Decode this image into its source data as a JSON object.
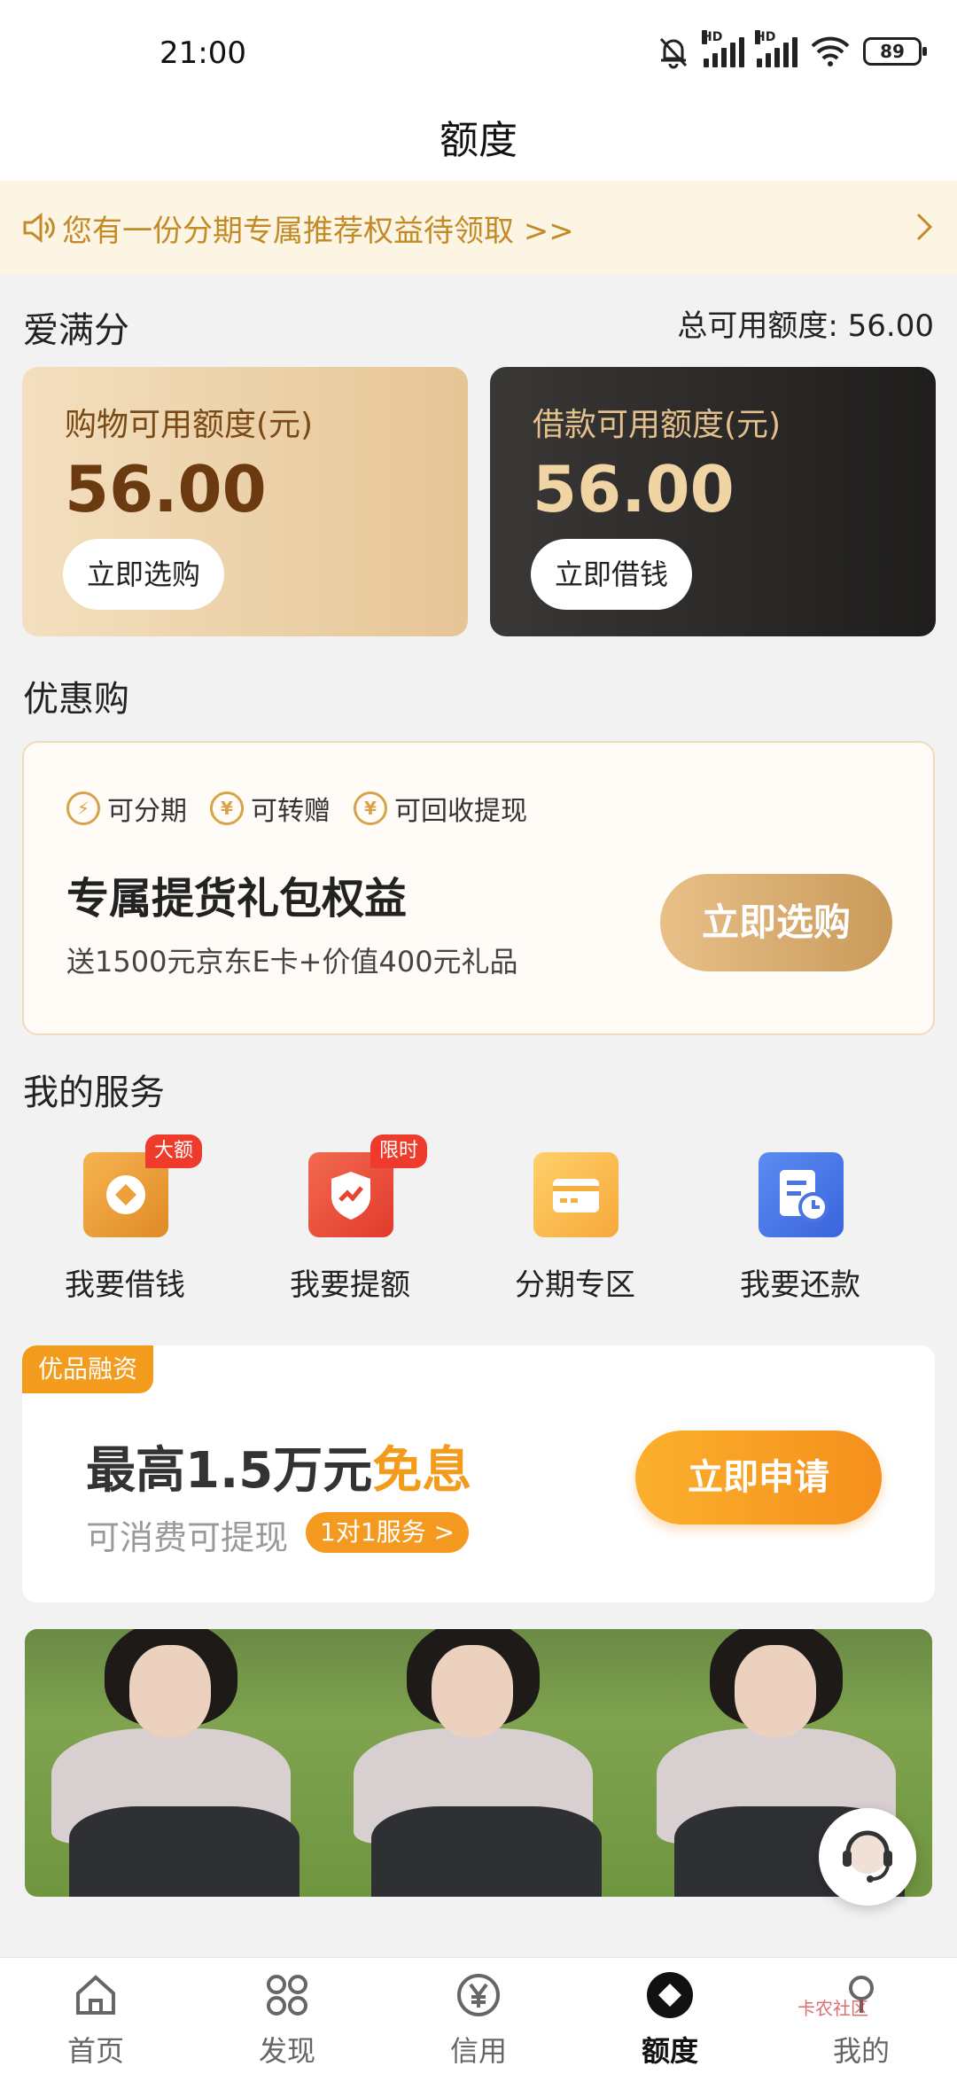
{
  "status": {
    "time": "21:00",
    "battery": "89",
    "hd": "HD"
  },
  "header": {
    "title": "额度"
  },
  "notice": {
    "text": "您有一份分期专属推荐权益待领取 >>"
  },
  "credit": {
    "section_title": "爱满分",
    "total": "总可用额度: 56.00",
    "shop": {
      "label": "购物可用额度(元)",
      "amount": "56.00",
      "button": "立即选购"
    },
    "loan": {
      "label": "借款可用额度(元)",
      "amount": "56.00",
      "button": "立即借钱"
    }
  },
  "promo": {
    "section_title": "优惠购",
    "features": [
      "可分期",
      "可转赠",
      "可回收提现"
    ],
    "title": "专属提货礼包权益",
    "subtitle": "送1500元京东E卡+价值400元礼品",
    "button": "立即选购"
  },
  "services": {
    "section_title": "我的服务",
    "items": [
      {
        "label": "我要借钱",
        "badge": "大额"
      },
      {
        "label": "我要提额",
        "badge": "限时"
      },
      {
        "label": "分期专区",
        "badge": ""
      },
      {
        "label": "我要还款",
        "badge": ""
      }
    ]
  },
  "finance": {
    "tag": "优品融资",
    "title_prefix": "最高1.5万元",
    "title_highlight": "免息",
    "subtitle": "可消费可提现",
    "pill": "1对1服务 >",
    "button": "立即申请"
  },
  "tabs": [
    {
      "label": "首页",
      "icon": "home-icon"
    },
    {
      "label": "发现",
      "icon": "grid-icon"
    },
    {
      "label": "信用",
      "icon": "yuan-icon"
    },
    {
      "label": "额度",
      "icon": "diamond-icon",
      "active": true
    },
    {
      "label": "我的",
      "icon": "profile-icon"
    }
  ],
  "watermark": "卡农社区",
  "colors": {
    "accent_gold": "#c38a28",
    "accent_orange": "#f39b1c",
    "badge_red": "#ee3b2b"
  }
}
